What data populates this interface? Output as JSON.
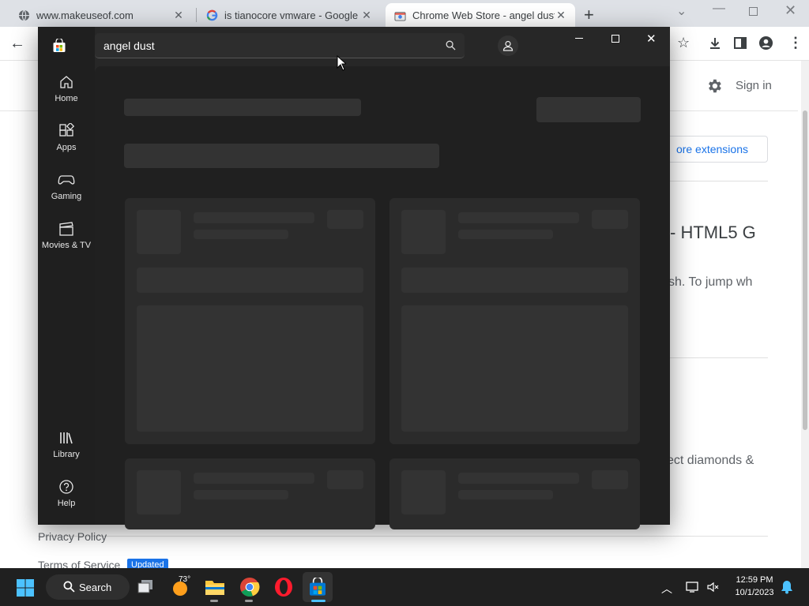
{
  "browser": {
    "tabs": [
      {
        "title": "www.makeuseof.com",
        "close": "✕"
      },
      {
        "title": "is tianocore vmware - Google Se",
        "close": "✕"
      },
      {
        "title": "Chrome Web Store - angel dust",
        "close": "✕"
      }
    ],
    "new_tab": "+"
  },
  "webstore_bg": {
    "sign_in": "Sign in",
    "more_extensions": "ore extensions",
    "heading_fragment": "- HTML5 G",
    "desc_fragment": "sh. To jump wh",
    "desc2_fragment": "ect diamonds &",
    "privacy": "Privacy Policy",
    "terms": "Terms of Service",
    "updated_badge": "Updated"
  },
  "store": {
    "search_value": "angel dust",
    "nav": [
      {
        "label": "Home",
        "icon": "home-icon"
      },
      {
        "label": "Apps",
        "icon": "apps-icon"
      },
      {
        "label": "Gaming",
        "icon": "gamepad-icon"
      },
      {
        "label": "Movies & TV",
        "icon": "clapperboard-icon"
      },
      {
        "label": "Library",
        "icon": "library-icon"
      },
      {
        "label": "Help",
        "icon": "help-icon"
      }
    ]
  },
  "taskbar": {
    "search_label": "Search",
    "weather_temp": "73°",
    "time": "12:59 PM",
    "date": "10/1/2023"
  },
  "colors": {
    "store_bg": "#272727",
    "taskbar_bg": "#202020",
    "accent": "#1a73e8"
  }
}
